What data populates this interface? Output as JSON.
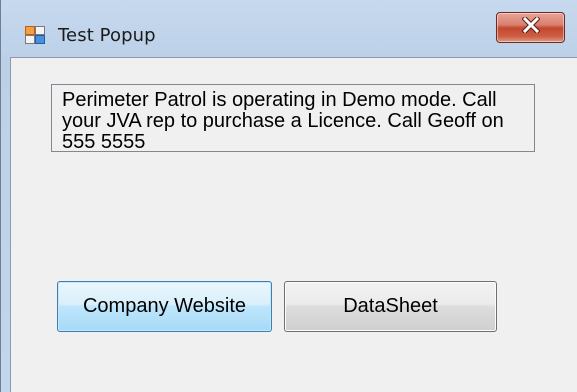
{
  "window": {
    "title": "Test Popup",
    "icon": "form-window-icon",
    "close_icon": "close-icon"
  },
  "message": {
    "text": "Perimeter Patrol is operating in Demo mode. Call your JVA rep to purchase a Licence. Call Geoff on 555 5555"
  },
  "buttons": {
    "company_website": "Company Website",
    "datasheet": "DataSheet"
  },
  "colors": {
    "title_bar": "#bfd3ea",
    "client_background": "#f0f0f0",
    "close_button": "#c3472f",
    "focused_button_border": "#3c7fb1"
  }
}
